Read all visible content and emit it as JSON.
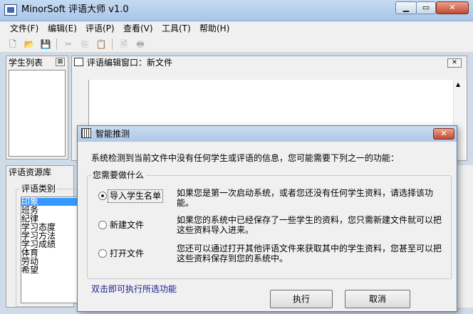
{
  "window": {
    "title": "MinorSoft 评语大师 v1.0",
    "minimize": "▁",
    "maximize": "▭",
    "close": "✕"
  },
  "menu": [
    "文件(F)",
    "编辑(E)",
    "评语(P)",
    "查看(V)",
    "工具(T)",
    "帮助(H)"
  ],
  "toolbar": {
    "new": "🗋",
    "open": "📂",
    "save": "💾",
    "cut": "✂",
    "copy": "⎘",
    "paste": "📋",
    "preview": "🗎",
    "print": "🖶"
  },
  "student_panel": {
    "title": "学生列表",
    "close": "⊠"
  },
  "editor_panel": {
    "title": "评语编辑窗口：新文件",
    "close": "✕",
    "scroll_up": "▲"
  },
  "resource_panel": {
    "title": "评语资源库",
    "category_legend": "评语类别",
    "categories": [
      "印象",
      "班务",
      "纪律",
      "学习态度",
      "学习方法",
      "学习成绩",
      "体育",
      "劳动",
      "希望"
    ],
    "selected": "印象"
  },
  "dialog": {
    "title": "智能推测",
    "close": "✕",
    "message": "系统检测到当前文件中没有任何学生或评语的信息，您可能需要下列之一的功能：",
    "group_legend": "您需要做什么",
    "options": [
      {
        "label": "导入学生名单",
        "checked": true,
        "desc": "如果您是第一次启动系统，或者您还没有任何学生资料，请选择该功能。"
      },
      {
        "label": "新建文件",
        "checked": false,
        "desc": "如果您的系统中已经保存了一些学生的资料，您只需新建文件就可以把这些资料导入进来。"
      },
      {
        "label": "打开文件",
        "checked": false,
        "desc": "您还可以通过打开其他评语文件来获取其中的学生资料，您甚至可以把这些资料保存到您的系统中。"
      }
    ],
    "hint": "双击即可执行所选功能",
    "ok": "执行",
    "cancel": "取消"
  },
  "colors": {
    "selection": "#3399ff",
    "desktop": "#cfdbe9",
    "hint_text": "#1a1a8c"
  }
}
